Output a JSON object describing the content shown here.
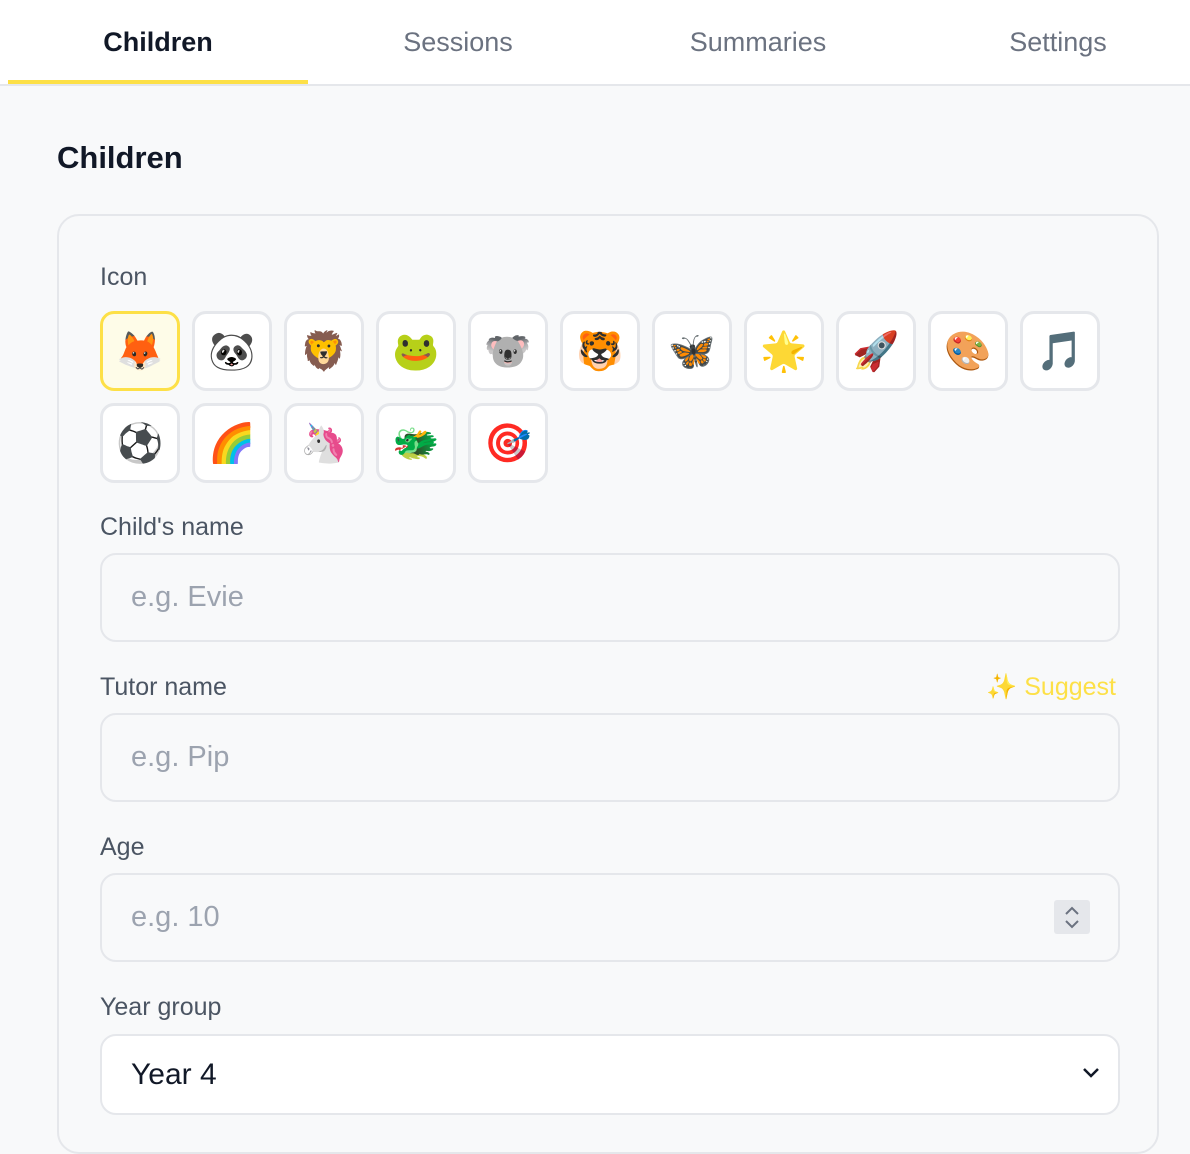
{
  "tabs": [
    {
      "label": "Children",
      "active": true
    },
    {
      "label": "Sessions",
      "active": false
    },
    {
      "label": "Summaries",
      "active": false
    },
    {
      "label": "Settings",
      "active": false
    }
  ],
  "page_title": "Children",
  "form": {
    "icon_label": "Icon",
    "icons": [
      {
        "emoji": "🦊",
        "name": "fox-icon",
        "selected": true
      },
      {
        "emoji": "🐼",
        "name": "panda-icon",
        "selected": false
      },
      {
        "emoji": "🦁",
        "name": "lion-icon",
        "selected": false
      },
      {
        "emoji": "🐸",
        "name": "frog-icon",
        "selected": false
      },
      {
        "emoji": "🐨",
        "name": "koala-icon",
        "selected": false
      },
      {
        "emoji": "🐯",
        "name": "tiger-icon",
        "selected": false
      },
      {
        "emoji": "🦋",
        "name": "butterfly-icon",
        "selected": false
      },
      {
        "emoji": "🌟",
        "name": "star-icon",
        "selected": false
      },
      {
        "emoji": "🚀",
        "name": "rocket-icon",
        "selected": false
      },
      {
        "emoji": "🎨",
        "name": "palette-icon",
        "selected": false
      },
      {
        "emoji": "🎵",
        "name": "music-note-icon",
        "selected": false
      },
      {
        "emoji": "⚽",
        "name": "soccer-ball-icon",
        "selected": false
      },
      {
        "emoji": "🌈",
        "name": "rainbow-icon",
        "selected": false
      },
      {
        "emoji": "🦄",
        "name": "unicorn-icon",
        "selected": false
      },
      {
        "emoji": "🐲",
        "name": "dragon-icon",
        "selected": false
      },
      {
        "emoji": "🎯",
        "name": "target-icon",
        "selected": false
      }
    ],
    "child_name_label": "Child's name",
    "child_name_placeholder": "e.g. Evie",
    "tutor_name_label": "Tutor name",
    "suggest_label": "✨ Suggest",
    "tutor_name_placeholder": "e.g. Pip",
    "age_label": "Age",
    "age_placeholder": "e.g. 10",
    "year_group_label": "Year group",
    "year_group_value": "Year 4"
  },
  "colors": {
    "accent": "#fde047",
    "border": "#e5e7eb",
    "background": "#f8f9fa"
  }
}
